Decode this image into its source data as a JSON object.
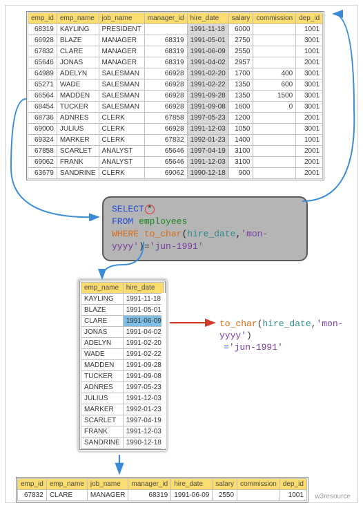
{
  "columns": [
    "emp_id",
    "emp_name",
    "job_name",
    "manager_id",
    "hire_date",
    "salary",
    "commission",
    "dep_id"
  ],
  "employees": [
    {
      "emp_id": 68319,
      "emp_name": "KAYLING",
      "job_name": "PRESIDENT",
      "manager_id": "",
      "hire_date": "1991-11-18",
      "salary": 6000,
      "commission": "",
      "dep_id": 1001
    },
    {
      "emp_id": 66928,
      "emp_name": "BLAZE",
      "job_name": "MANAGER",
      "manager_id": 68319,
      "hire_date": "1991-05-01",
      "salary": 2750,
      "commission": "",
      "dep_id": 3001
    },
    {
      "emp_id": 67832,
      "emp_name": "CLARE",
      "job_name": "MANAGER",
      "manager_id": 68319,
      "hire_date": "1991-06-09",
      "salary": 2550,
      "commission": "",
      "dep_id": 1001
    },
    {
      "emp_id": 65646,
      "emp_name": "JONAS",
      "job_name": "MANAGER",
      "manager_id": 68319,
      "hire_date": "1991-04-02",
      "salary": 2957,
      "commission": "",
      "dep_id": 2001
    },
    {
      "emp_id": 64989,
      "emp_name": "ADELYN",
      "job_name": "SALESMAN",
      "manager_id": 66928,
      "hire_date": "1991-02-20",
      "salary": 1700,
      "commission": 400,
      "dep_id": 3001
    },
    {
      "emp_id": 65271,
      "emp_name": "WADE",
      "job_name": "SALESMAN",
      "manager_id": 66928,
      "hire_date": "1991-02-22",
      "salary": 1350,
      "commission": 600,
      "dep_id": 3001
    },
    {
      "emp_id": 66564,
      "emp_name": "MADDEN",
      "job_name": "SALESMAN",
      "manager_id": 66928,
      "hire_date": "1991-09-28",
      "salary": 1350,
      "commission": 1500,
      "dep_id": 3001
    },
    {
      "emp_id": 68454,
      "emp_name": "TUCKER",
      "job_name": "SALESMAN",
      "manager_id": 66928,
      "hire_date": "1991-09-08",
      "salary": 1600,
      "commission": 0,
      "dep_id": 3001
    },
    {
      "emp_id": 68736,
      "emp_name": "ADNRES",
      "job_name": "CLERK",
      "manager_id": 67858,
      "hire_date": "1997-05-23",
      "salary": 1200,
      "commission": "",
      "dep_id": 2001
    },
    {
      "emp_id": 69000,
      "emp_name": "JULIUS",
      "job_name": "CLERK",
      "manager_id": 66928,
      "hire_date": "1991-12-03",
      "salary": 1050,
      "commission": "",
      "dep_id": 3001
    },
    {
      "emp_id": 69324,
      "emp_name": "MARKER",
      "job_name": "CLERK",
      "manager_id": 67832,
      "hire_date": "1992-01-23",
      "salary": 1400,
      "commission": "",
      "dep_id": 1001
    },
    {
      "emp_id": 67858,
      "emp_name": "SCARLET",
      "job_name": "ANALYST",
      "manager_id": 65646,
      "hire_date": "1997-04-19",
      "salary": 3100,
      "commission": "",
      "dep_id": 2001
    },
    {
      "emp_id": 69062,
      "emp_name": "FRANK",
      "job_name": "ANALYST",
      "manager_id": 65646,
      "hire_date": "1991-12-03",
      "salary": 3100,
      "commission": "",
      "dep_id": 2001
    },
    {
      "emp_id": 63679,
      "emp_name": "SANDRINE",
      "job_name": "CLERK",
      "manager_id": 69062,
      "hire_date": "1990-12-18",
      "salary": 900,
      "commission": "",
      "dep_id": 2001
    }
  ],
  "sql": {
    "select_kw": "SELECT",
    "star": "*",
    "from_kw": "FROM",
    "table": "employees",
    "where_kw": "WHERE",
    "func": "to_char",
    "col": "hire_date",
    "fmt": "'mon-yyyy'",
    "eq": "=",
    "val": "'jun-1991'"
  },
  "projection_cols": [
    "emp_name",
    "hire_date"
  ],
  "projection_rows": [
    {
      "emp_name": "KAYLING",
      "hire_date": "1991-11-18"
    },
    {
      "emp_name": "BLAZE",
      "hire_date": "1991-05-01"
    },
    {
      "emp_name": "CLARE",
      "hire_date": "1991-06-09",
      "highlight": true
    },
    {
      "emp_name": "JONAS",
      "hire_date": "1991-04-02"
    },
    {
      "emp_name": "ADELYN",
      "hire_date": "1991-02-20"
    },
    {
      "emp_name": "WADE",
      "hire_date": "1991-02-22"
    },
    {
      "emp_name": "MADDEN",
      "hire_date": "1991-09-28"
    },
    {
      "emp_name": "TUCKER",
      "hire_date": "1991-09-08"
    },
    {
      "emp_name": "ADNRES",
      "hire_date": "1997-05-23"
    },
    {
      "emp_name": "JULIUS",
      "hire_date": "1991-12-03"
    },
    {
      "emp_name": "MARKER",
      "hire_date": "1992-01-23"
    },
    {
      "emp_name": "SCARLET",
      "hire_date": "1997-04-19"
    },
    {
      "emp_name": "FRANK",
      "hire_date": "1991-12-03"
    },
    {
      "emp_name": "SANDRINE",
      "hire_date": "1990-12-18"
    }
  ],
  "annotation": {
    "line1_func": "to_char",
    "line1_open": "(",
    "line1_col": "hire_date",
    "line1_comma": ",",
    "line1_fmt": "'mon-yyyy'",
    "line1_close": ")",
    "line2_eq": "=",
    "line2_val": "'jun-1991'"
  },
  "result_row": {
    "emp_id": 67832,
    "emp_name": "CLARE",
    "job_name": "MANAGER",
    "manager_id": 68319,
    "hire_date": "1991-06-09",
    "salary": 2550,
    "commission": "",
    "dep_id": 1001
  },
  "footer": "w3resource"
}
